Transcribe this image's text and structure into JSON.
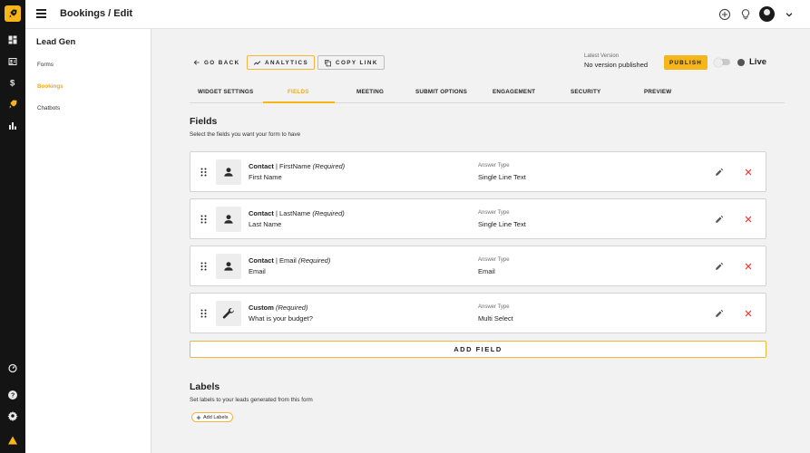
{
  "app": {
    "brand_color": "#f6b619",
    "accent_color": "#f3a91a",
    "danger_color": "#e53935"
  },
  "header": {
    "title": "Bookings / Edit"
  },
  "rail": {
    "icons": [
      "rocket-logo-icon",
      "dashboard-icon",
      "contacts-icon",
      "dollar-icon",
      "rocket-icon",
      "bar-chart-icon",
      "speedometer-icon",
      "help-icon",
      "settings-icon",
      "warning-icon"
    ]
  },
  "sidebar": {
    "title": "Lead Gen",
    "items": [
      {
        "label": "Forms",
        "active": false
      },
      {
        "label": "Bookings",
        "active": true
      },
      {
        "label": "Chatbots",
        "active": false
      }
    ]
  },
  "toolbar": {
    "go_back": "GO BACK",
    "analytics": "ANALYTICS",
    "copy_link": "COPY LINK",
    "version_label": "Latest Version",
    "version_value": "No version published",
    "publish": "PUBLISH",
    "live": "Live"
  },
  "tabs": [
    {
      "label": "WIDGET SETTINGS"
    },
    {
      "label": "FIELDS",
      "active": true
    },
    {
      "label": "MEETING"
    },
    {
      "label": "SUBMIT OPTIONS"
    },
    {
      "label": "ENGAGEMENT"
    },
    {
      "label": "SECURITY"
    },
    {
      "label": "PREVIEW"
    }
  ],
  "fields_section": {
    "title": "Fields",
    "subtitle": "Select the fields you want your form to have",
    "answer_type_label": "Answer Type",
    "rows": [
      {
        "category": "Contact",
        "separator": " | ",
        "field": "FirstName",
        "required": "(Required)",
        "name": "First Name",
        "answer_type": "Single Line Text",
        "icon": "person-icon"
      },
      {
        "category": "Contact",
        "separator": " | ",
        "field": "LastName",
        "required": "(Required)",
        "name": "Last Name",
        "answer_type": "Single Line Text",
        "icon": "person-icon"
      },
      {
        "category": "Contact",
        "separator": " | ",
        "field": "Email",
        "required": "(Required)",
        "name": "Email",
        "answer_type": "Email",
        "icon": "person-icon"
      },
      {
        "category": "Custom",
        "separator": "",
        "field": "",
        "required": "(Required)",
        "name": "What is your budget?",
        "answer_type": "Multi Select",
        "icon": "wrench-icon"
      }
    ],
    "add_field": "ADD FIELD"
  },
  "labels_section": {
    "title": "Labels",
    "subtitle": "Set labels to your leads generated from this form",
    "add_labels": "Add Labels"
  }
}
